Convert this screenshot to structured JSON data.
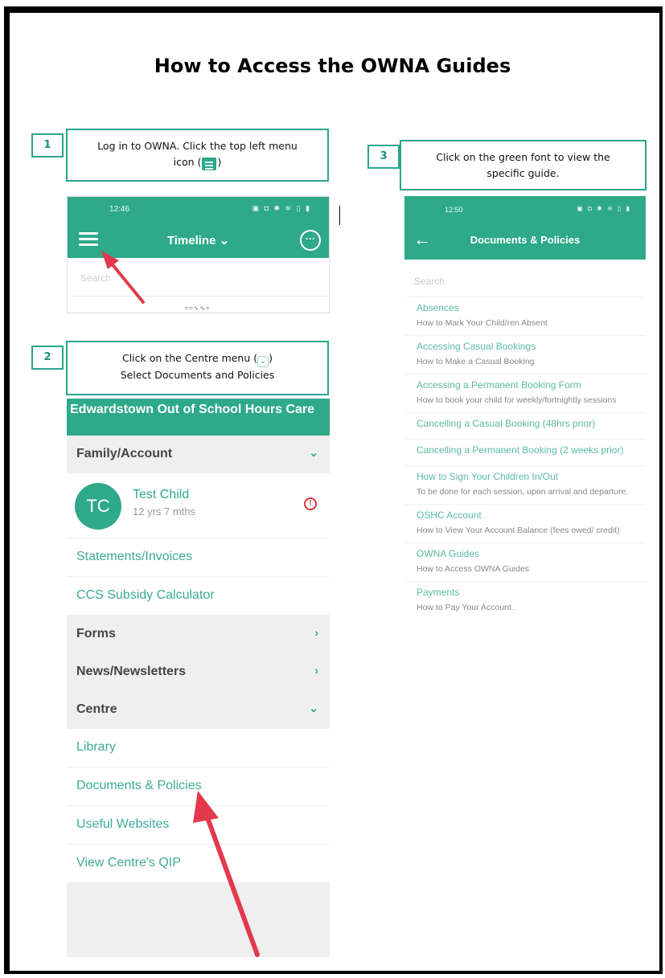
{
  "title": "How to Access the OWNA Guides",
  "steps": {
    "s1": {
      "num": "1",
      "line1": "Log in to OWNA. Click the top left menu",
      "line2a": "icon (",
      "line2b": ")"
    },
    "s2": {
      "num": "2",
      "line1a": "Click on the Centre menu (",
      "line1b": ")",
      "line2": "Select Documents and Policies"
    },
    "s3": {
      "num": "3",
      "line1": "Click on the green font to view the",
      "line2": "specific guide."
    }
  },
  "screen1": {
    "time": "12:46",
    "status_icons": "▣ ◘ ✱ ≋ ▯ ▮",
    "title": "Timeline",
    "chevron": "⌄",
    "more": "···",
    "search_placeholder": "Search",
    "logo_fragment": "≈≈∿∿≈"
  },
  "screen2": {
    "header": "Edwardstown Out of School Hours Care",
    "family_section": "Family/Account",
    "child": {
      "initials": "TC",
      "name": "Test Child",
      "age": "12 yrs 7 mths",
      "alert": "!"
    },
    "links_top": [
      "Statements/Invoices",
      "CCS Subsidy Calculator"
    ],
    "sections": [
      {
        "label": "Forms",
        "chevron": "›"
      },
      {
        "label": "News/Newsletters",
        "chevron": "›"
      },
      {
        "label": "Centre",
        "chevron": "⌄"
      }
    ],
    "family_chevron": "⌄",
    "centre_links": [
      "Library",
      "Documents & Policies",
      "Useful Websites",
      "View Centre's QIP"
    ]
  },
  "screen3": {
    "time": "12:50",
    "status_icons": "▣ ◘ ✱ ≋ ▯ ▮",
    "back": "←",
    "title": "Documents & Policies",
    "search_placeholder": "Search",
    "guides": [
      {
        "title": "Absences",
        "sub": "How to Mark Your Child/ren Absent"
      },
      {
        "title": "Accessing Casual Bookings",
        "sub": "How to Make a Casual Booking"
      },
      {
        "title": "Accessing a Permanent Booking Form",
        "sub": "How to book your child for weekly/fortnightly sessions"
      },
      {
        "title": "Cancelling a Casual Booking (48hrs prior)",
        "sub": ""
      },
      {
        "title": "Cancelling a Permanent Booking (2 weeks prior)",
        "sub": ""
      },
      {
        "title": "How to Sign Your Children In/Out",
        "sub": "To be done for each session, upon arrival and departure."
      },
      {
        "title": "OSHC Account",
        "sub": "How to View Your Account Balance (fees owed/ credit)"
      },
      {
        "title": "OWNA Guides",
        "sub": "How to Access OWNA Guides"
      },
      {
        "title": "Payments",
        "sub": "How to Pay Your Account.."
      }
    ]
  },
  "colors": {
    "teal": "#2ea98a",
    "box_border": "#29a58e",
    "arrow_red": "#e23a4c",
    "link_green": "#3cab93"
  }
}
